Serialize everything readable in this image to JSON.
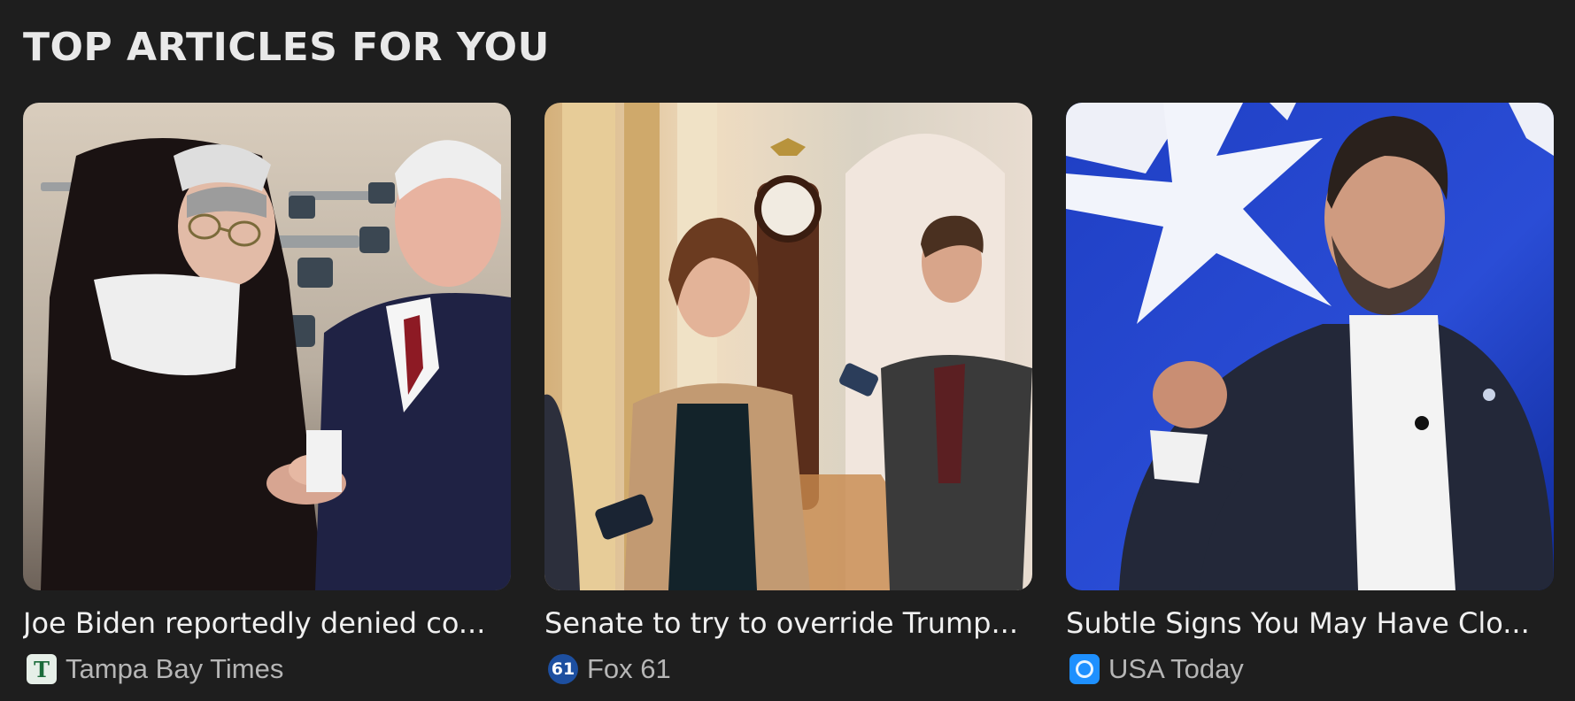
{
  "section": {
    "title": "TOP ARTICLES FOR YOU"
  },
  "articles": [
    {
      "headline": "Joe Biden reportedly denied co...",
      "source": "Tampa Bay Times",
      "source_icon": "tampa-bay-times-logo-icon",
      "source_icon_glyph": "T",
      "source_icon_bg": "#e6efe8",
      "source_icon_color": "#1b6b3a",
      "image": "photo-nun-and-joe-biden-in-classroom"
    },
    {
      "headline": "Senate to try to override Trump...",
      "source": "Fox 61",
      "source_icon": "fox-61-logo-icon",
      "source_icon_glyph": "61",
      "source_icon_bg": "#1d4fa0",
      "source_icon_color": "#ffffff",
      "image": "photo-senator-talking-to-reporters-in-capitol-hallway"
    },
    {
      "headline": "Subtle Signs You May Have Clo...",
      "source": "USA Today",
      "source_icon": "usa-today-logo-icon",
      "source_icon_glyph": "",
      "source_icon_bg": "#1e90ff",
      "source_icon_color": "#ffffff",
      "image": "photo-man-speaking-at-podium-blue-backdrop"
    }
  ]
}
